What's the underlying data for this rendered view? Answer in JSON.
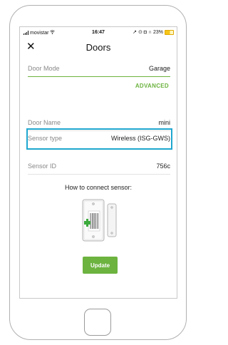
{
  "status_bar": {
    "carrier": "movistar",
    "time": "16:47",
    "indicators": "↗ ⊙ ◘ ∩",
    "battery": "23%"
  },
  "header": {
    "close_icon": "✕",
    "title": "Doors"
  },
  "fields": {
    "door_mode": {
      "label": "Door Mode",
      "value": "Garage"
    },
    "door_name": {
      "label": "Door Name",
      "value": "mini"
    },
    "sensor_type": {
      "label": "Sensor type",
      "value": "Wireless (ISG-GWS)"
    },
    "sensor_id": {
      "label": "Sensor ID",
      "value": "756c"
    }
  },
  "advanced_label": "ADVANCED",
  "connect_heading": "How to connect sensor:",
  "update_label": "Update",
  "colors": {
    "accent_green": "#6cb33f",
    "highlight_blue": "#1fa7cf",
    "battery_yellow": "#f5c518"
  },
  "icons": [
    "signal-icon",
    "wifi-icon",
    "battery-icon",
    "close-icon",
    "door-sensor-illustration"
  ]
}
